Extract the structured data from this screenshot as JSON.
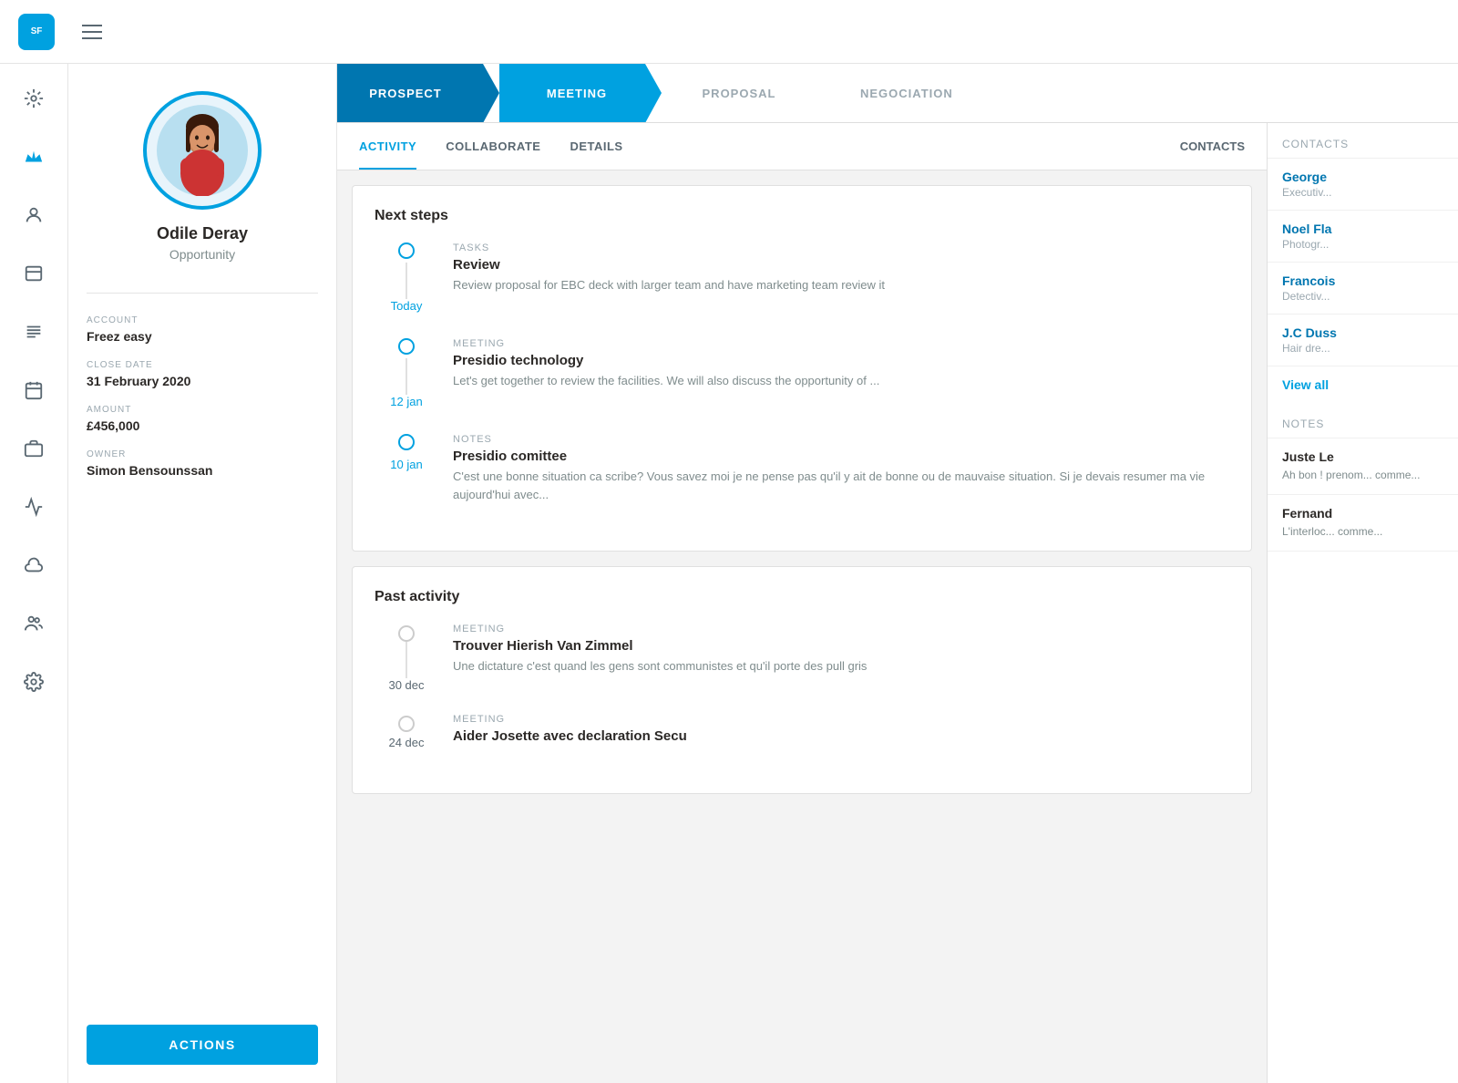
{
  "topbar": {
    "logo_text": "SF"
  },
  "pipeline": {
    "stages": [
      {
        "id": "prospect",
        "label": "PROSPECT",
        "state": "completed"
      },
      {
        "id": "meeting",
        "label": "MEETING",
        "state": "active"
      },
      {
        "id": "proposal",
        "label": "PROPOSAL",
        "state": "inactive"
      },
      {
        "id": "negociation",
        "label": "NEGOCIATION",
        "state": "inactive"
      }
    ]
  },
  "tabs": {
    "items": [
      {
        "id": "activity",
        "label": "ACTIVITY",
        "active": true
      },
      {
        "id": "collaborate",
        "label": "COLLABORATE",
        "active": false
      },
      {
        "id": "details",
        "label": "DETAILS",
        "active": false
      }
    ],
    "right_label": "CONTACTS"
  },
  "profile": {
    "name": "Odile Deray",
    "role": "Opportunity",
    "account_label": "ACCOUNT",
    "account_value": "Freez easy",
    "close_date_label": "CLOSE DATE",
    "close_date_value": "31 February 2020",
    "amount_label": "AMOUNT",
    "amount_value": "£456,000",
    "owner_label": "OWNER",
    "owner_value": "Simon Bensounssan",
    "actions_label": "ACTIONS"
  },
  "next_steps": {
    "title": "Next steps",
    "items": [
      {
        "date": "Today",
        "type": "TASKS",
        "title": "Review",
        "description": "Review proposal for EBC deck with larger team and have marketing team review it"
      },
      {
        "date": "12 jan",
        "type": "MEETING",
        "title": "Presidio technology",
        "description": "Let's get together to review the facilities. We will also discuss the opportunity of ..."
      },
      {
        "date": "10 jan",
        "type": "NOTES",
        "title": "Presidio comittee",
        "description": "C'est une bonne situation ca scribe? Vous savez moi je ne pense pas qu'il y ait de bonne ou de mauvaise situation. Si je devais resumer ma vie aujourd'hui avec..."
      }
    ]
  },
  "past_activity": {
    "title": "Past activity",
    "items": [
      {
        "date": "30 dec",
        "type": "MEETING",
        "title": "Trouver Hierish Van Zimmel",
        "description": "Une dictature c'est quand les gens sont communistes et qu'il porte des pull gris"
      },
      {
        "date": "24 dec",
        "type": "MEETING",
        "title": "Aider Josette avec declaration Secu",
        "description": ""
      }
    ]
  },
  "contacts": {
    "title": "CONTACTS",
    "items": [
      {
        "name": "George",
        "role": "Executiv..."
      },
      {
        "name": "Noel Fla",
        "role": "Photogr..."
      },
      {
        "name": "Francois",
        "role": "Detectiv..."
      },
      {
        "name": "J.C Duss",
        "role": "Hair dre..."
      }
    ],
    "view_all_label": "View all"
  },
  "notes": {
    "title": "NOTES",
    "items": [
      {
        "name": "Juste Le",
        "description": "Ah bon ! prenom... comme..."
      },
      {
        "name": "Fernand",
        "description": "L'interloc... comme..."
      }
    ]
  }
}
